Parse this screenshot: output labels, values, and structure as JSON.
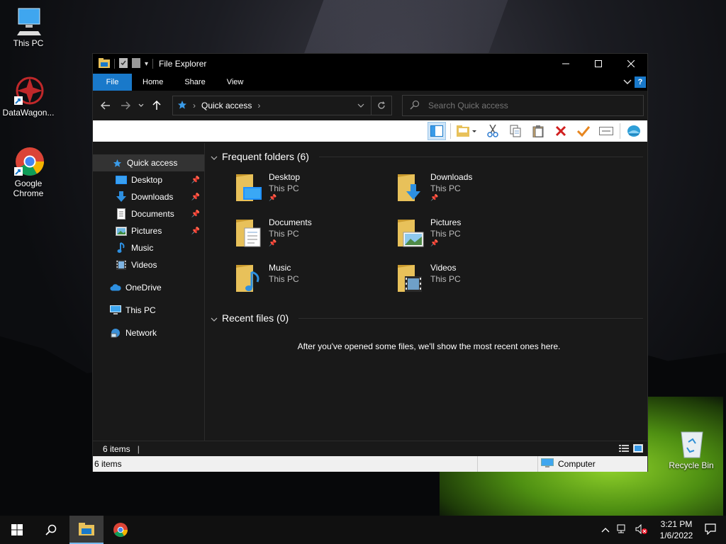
{
  "desktop": {
    "icons": [
      {
        "label": "This PC"
      },
      {
        "label": "DataWagon..."
      },
      {
        "label": "Google\nChrome"
      },
      {
        "label": "Recycle Bin"
      }
    ]
  },
  "window": {
    "title": "File Explorer",
    "ribbon_tabs": [
      "File",
      "Home",
      "Share",
      "View"
    ],
    "help_label": "?",
    "address": {
      "crumb": "Quick access"
    },
    "search": {
      "placeholder": "Search Quick access"
    },
    "nav": {
      "quick_access": "Quick access",
      "pinned": [
        "Desktop",
        "Downloads",
        "Documents",
        "Pictures"
      ],
      "unpinned": [
        "Music",
        "Videos"
      ],
      "onedrive": "OneDrive",
      "this_pc": "This PC",
      "network": "Network"
    },
    "frequent": {
      "header": "Frequent folders (6)",
      "folders": [
        {
          "name": "Desktop",
          "location": "This PC"
        },
        {
          "name": "Downloads",
          "location": "This PC"
        },
        {
          "name": "Documents",
          "location": "This PC"
        },
        {
          "name": "Pictures",
          "location": "This PC"
        },
        {
          "name": "Music",
          "location": "This PC"
        },
        {
          "name": "Videos",
          "location": "This PC"
        }
      ]
    },
    "recent": {
      "header": "Recent files (0)",
      "message": "After you've opened some files, we'll show the most recent ones here."
    },
    "status": {
      "items": "6 items",
      "items2": "6 items",
      "location": "Computer"
    }
  },
  "taskbar": {
    "time": "3:21 PM",
    "date": "1/6/2022"
  },
  "colors": {
    "accent": "#1979ca",
    "folder": "#e8c15a",
    "dark_bg": "#191919"
  }
}
